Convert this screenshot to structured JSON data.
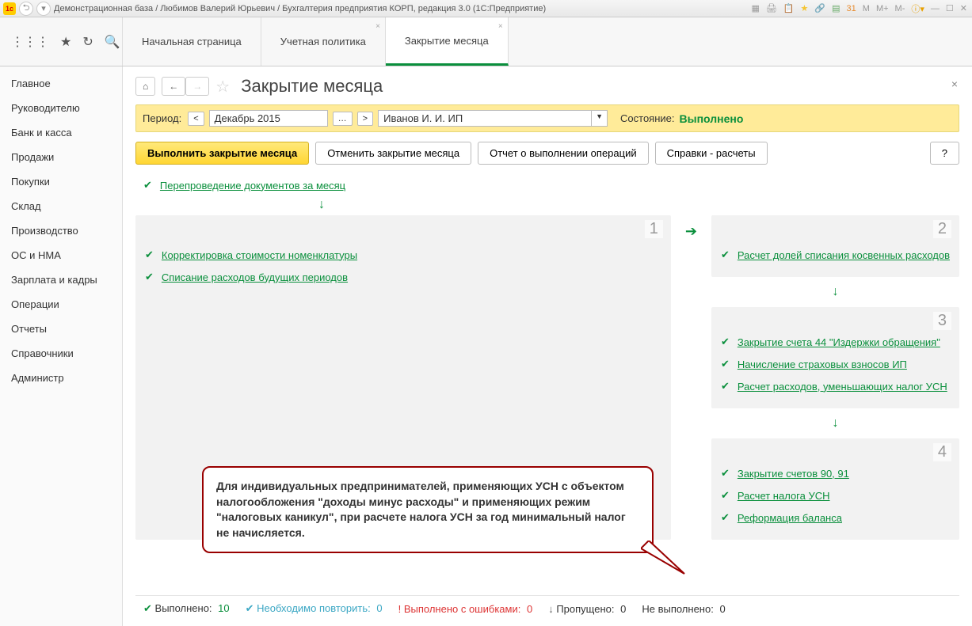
{
  "titlebar": {
    "text": "Демонстрационная база / Любимов Валерий Юрьевич / Бухгалтерия предприятия КОРП, редакция 3.0  (1С:Предприятие)",
    "icons": [
      "M",
      "M+",
      "M-"
    ]
  },
  "tabs": {
    "start": "Начальная страница",
    "t1": "Учетная политика",
    "t2": "Закрытие месяца"
  },
  "sidebar": {
    "items": [
      "Главное",
      "Руководителю",
      "Банк и касса",
      "Продажи",
      "Покупки",
      "Склад",
      "Производство",
      "ОС и НМА",
      "Зарплата и кадры",
      "Операции",
      "Отчеты",
      "Справочники",
      "Администр"
    ]
  },
  "page": {
    "title": "Закрытие месяца",
    "period_label": "Период:",
    "period_value": "Декабрь 2015",
    "org_value": "Иванов И. И. ИП",
    "state_label": "Состояние:",
    "state_value": "Выполнено"
  },
  "buttons": {
    "execute": "Выполнить закрытие месяца",
    "cancel": "Отменить закрытие месяца",
    "report": "Отчет о выполнении операций",
    "refs": "Справки - расчеты",
    "help": "?"
  },
  "operations": {
    "reprov": "Перепроведение документов за месяц",
    "block1": {
      "num": "1",
      "items": [
        "Корректировка стоимости номенклатуры",
        "Списание расходов будущих периодов"
      ]
    },
    "block2": {
      "num": "2",
      "items": [
        "Расчет долей списания косвенных расходов"
      ]
    },
    "block3": {
      "num": "3",
      "items": [
        "Закрытие счета 44 \"Издержки обращения\"",
        "Начисление страховых взносов ИП",
        "Расчет расходов, уменьшающих налог УСН"
      ]
    },
    "block4": {
      "num": "4",
      "items": [
        "Закрытие счетов 90, 91",
        "Расчет налога УСН",
        "Реформация баланса"
      ]
    }
  },
  "callout": {
    "text": "Для индивидуальных предпринимателей, применяющих УСН с объектом налогообложения \"доходы минус расходы\" и применяющих режим \"налоговых каникул\", при расчете налога УСН за год минимальный налог не начисляется."
  },
  "status": {
    "done_label": "Выполнено:",
    "done_count": "10",
    "repeat_label": "Необходимо повторить:",
    "repeat_count": "0",
    "error_label": "Выполнено с ошибками:",
    "error_count": "0",
    "skip_label": "Пропущено:",
    "skip_count": "0",
    "notdone_label": "Не выполнено:",
    "notdone_count": "0"
  }
}
